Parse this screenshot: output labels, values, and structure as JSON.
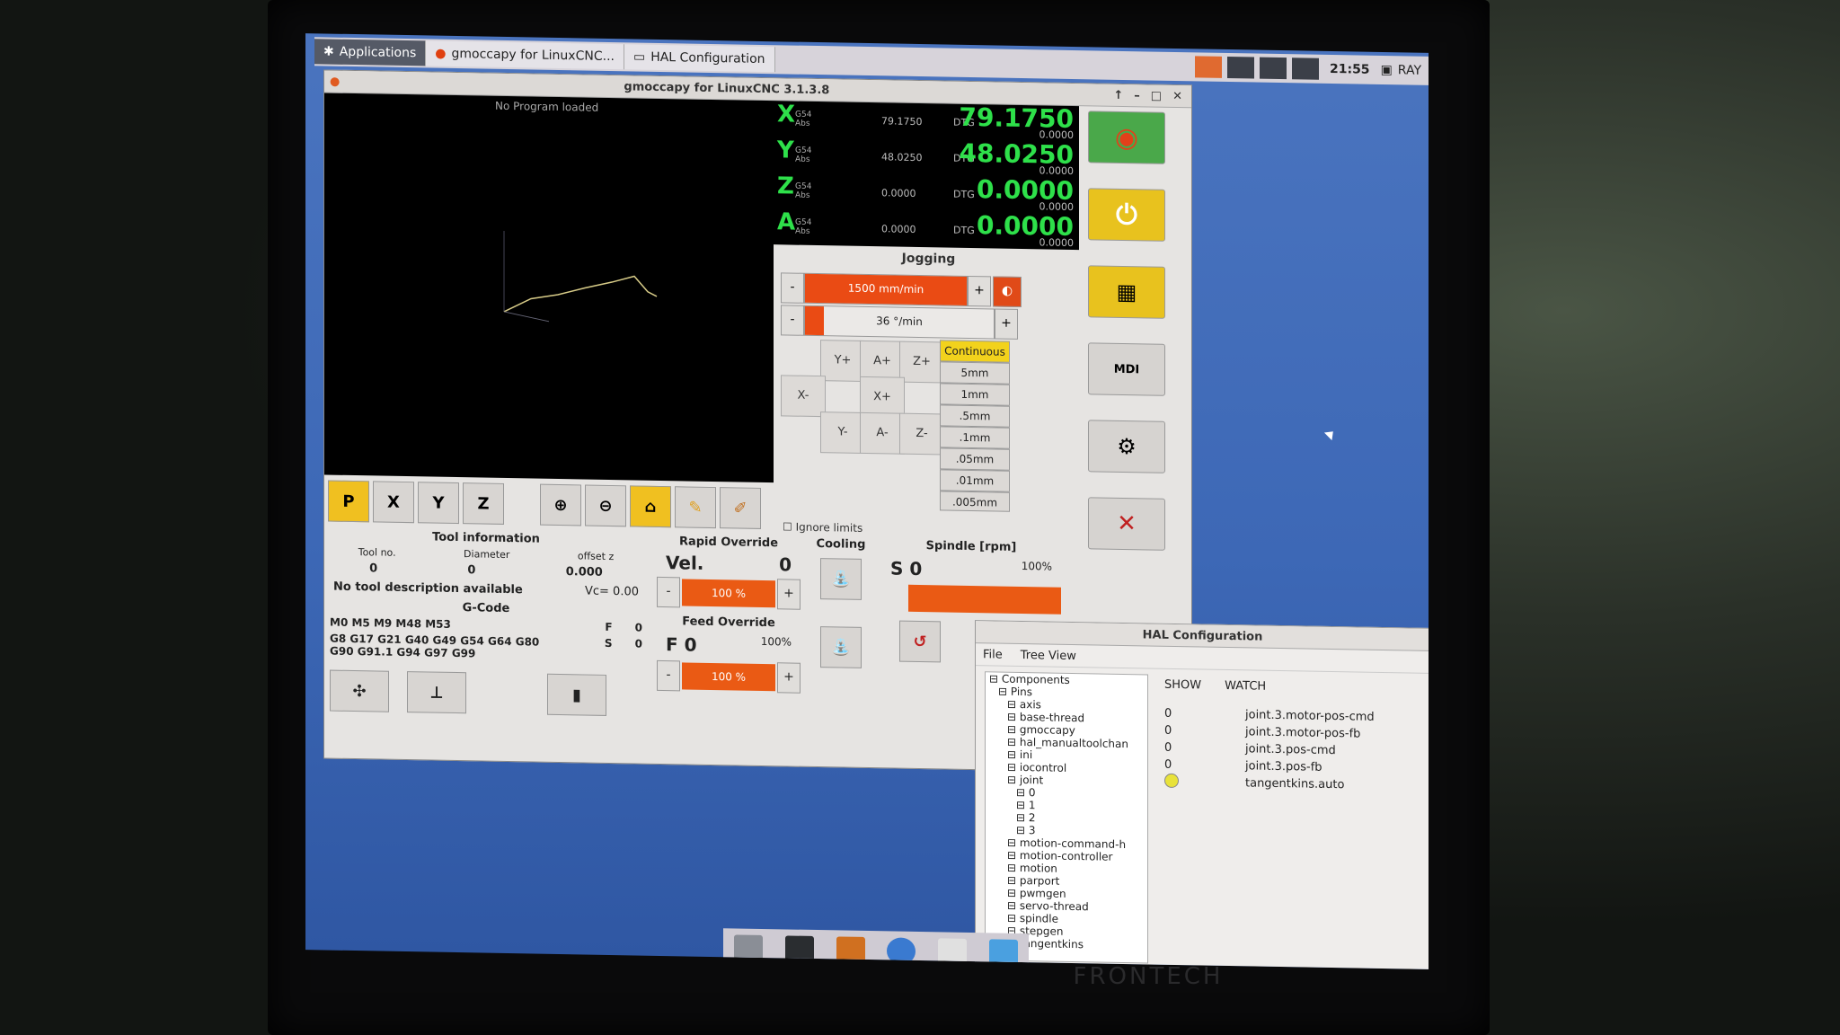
{
  "panel": {
    "tabs": [
      "Applications",
      "gmoccapy for LinuxCNC...",
      "HAL Configuration"
    ],
    "clock": "21:55",
    "user": "RAY"
  },
  "main_window": {
    "title": "gmoccapy for LinuxCNC  3.1.3.8",
    "preview_message": "No Program loaded"
  },
  "dro": [
    {
      "axis": "X",
      "sub": "G54",
      "abs_label": "Abs",
      "abs": "79.1750",
      "dtg_label": "DTG",
      "value": "79.1750",
      "dtg": "0.0000"
    },
    {
      "axis": "Y",
      "sub": "G54",
      "abs_label": "Abs",
      "abs": "48.0250",
      "dtg_label": "DTG",
      "value": "48.0250",
      "dtg": "0.0000"
    },
    {
      "axis": "Z",
      "sub": "G54",
      "abs_label": "Abs",
      "abs": "0.0000",
      "dtg_label": "DTG",
      "value": "0.0000",
      "dtg": "0.0000"
    },
    {
      "axis": "A",
      "sub": "G54",
      "abs_label": "Abs",
      "abs": "0.0000",
      "dtg_label": "DTG",
      "value": "0.0000",
      "dtg": "0.0000"
    }
  ],
  "jogging": {
    "title": "Jogging",
    "speed": "1500 mm/min",
    "angular": "36 °/min",
    "buttons": [
      "Y+",
      "A+",
      "Z+",
      "X-",
      "X+",
      "Y-",
      "A-",
      "Z-"
    ],
    "increments": [
      "Continuous",
      "5mm",
      "1mm",
      ".5mm",
      ".1mm",
      ".05mm",
      ".01mm",
      ".005mm"
    ],
    "ignore_limits": "Ignore limits"
  },
  "toolbar": {
    "labels": [
      "P",
      "X",
      "Y",
      "Z"
    ]
  },
  "side": {
    "mdi": "MDI"
  },
  "tool_info": {
    "title": "Tool information",
    "headers": [
      "Tool no.",
      "Diameter",
      "offset z"
    ],
    "values": [
      "0",
      "0",
      "0.000"
    ],
    "description": "No tool description available",
    "vc": "Vc= 0.00"
  },
  "gcode": {
    "title": "G-Code",
    "mcodes": "M0 M5 M9 M48 M53",
    "gcodes_1": "G8 G17 G21 G40 G49 G54 G64 G80",
    "gcodes_2": "G90 G91.1 G94 G97 G99",
    "f_label": "F",
    "f_value": "0",
    "s_label": "S",
    "s_value": "0"
  },
  "rapid": {
    "title": "Rapid Override",
    "vel_label": "Vel.",
    "vel": "0",
    "pct": "100 %"
  },
  "feed": {
    "title": "Feed Override",
    "f": "F  0",
    "pct_label": "100%",
    "pct": "100 %"
  },
  "cooling": {
    "title": "Cooling"
  },
  "spindle": {
    "title": "Spindle [rpm]",
    "s": "S  0",
    "pct": "100%"
  },
  "hal": {
    "title": "HAL Configuration",
    "menu": [
      "File",
      "Tree View"
    ],
    "tree": [
      "Components",
      "Pins",
      "axis",
      "base-thread",
      "gmoccapy",
      "hal_manualtoolchan",
      "ini",
      "iocontrol",
      "joint",
      "0",
      "1",
      "2",
      "3",
      "motion-command-h",
      "motion-controller",
      "motion",
      "parport",
      "pwmgen",
      "servo-thread",
      "spindle",
      "stepgen",
      "tangentkins"
    ],
    "tabs": [
      "SHOW",
      "WATCH"
    ],
    "watch": [
      {
        "value": "0",
        "name": "joint.3.motor-pos-cmd"
      },
      {
        "value": "0",
        "name": "joint.3.motor-pos-fb"
      },
      {
        "value": "0",
        "name": "joint.3.pos-cmd"
      },
      {
        "value": "0",
        "name": "joint.3.pos-fb"
      },
      {
        "value": "",
        "name": "tangentkins.auto"
      }
    ]
  },
  "colors": {
    "dro_green": "#2ee04a",
    "orange": "#ea4b14",
    "yellow": "#f0c020",
    "desktop": "#3d68b6"
  },
  "brand": "FRONTECH"
}
